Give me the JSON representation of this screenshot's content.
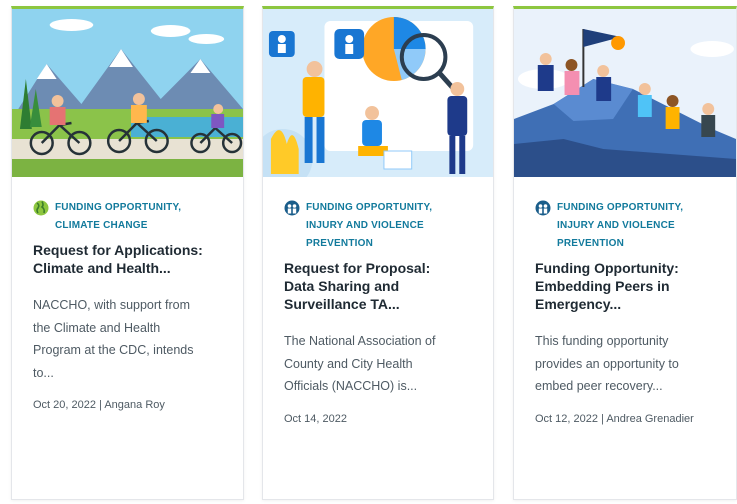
{
  "cards": [
    {
      "category_lines": [
        "FUNDING OPPORTUNITY,",
        "CLIMATE CHANGE"
      ],
      "title_lines": [
        "Request for Applications:",
        "Climate and Health..."
      ],
      "excerpt_lines": [
        "NACCHO, with support from",
        "the Climate and Health",
        "Program at the CDC, intends",
        "to..."
      ],
      "meta": "Oct 20, 2022 | Angana Roy"
    },
    {
      "category_lines": [
        "FUNDING OPPORTUNITY,",
        "INJURY AND VIOLENCE",
        "PREVENTION"
      ],
      "title_lines": [
        "Request for Proposal:",
        "Data Sharing and",
        "Surveillance TA..."
      ],
      "excerpt_lines": [
        "The National Association of",
        "County and City Health",
        "Officials (NACCHO) is..."
      ],
      "meta": "Oct 14, 2022"
    },
    {
      "category_lines": [
        "FUNDING OPPORTUNITY,",
        "INJURY AND VIOLENCE",
        "PREVENTION"
      ],
      "title_lines": [
        "Funding Opportunity:",
        "Embedding Peers in",
        "Emergency..."
      ],
      "excerpt_lines": [
        "This funding opportunity",
        "provides an opportunity to",
        "embed peer recovery..."
      ],
      "meta": "Oct 12, 2022 | Andrea Grenadier"
    }
  ],
  "icons": {
    "card1_image": "cyclists-illustration",
    "card2_image": "data-analysis-illustration",
    "card3_image": "team-climbing-illustration",
    "card1_category": "globe-icon",
    "card2_category": "people-icon",
    "card3_category": "people-icon"
  },
  "colors": {
    "accent_border": "#8dc63f",
    "category_text": "#127a9c",
    "title_text": "#1f2a33",
    "body_text": "#4e5a63"
  }
}
